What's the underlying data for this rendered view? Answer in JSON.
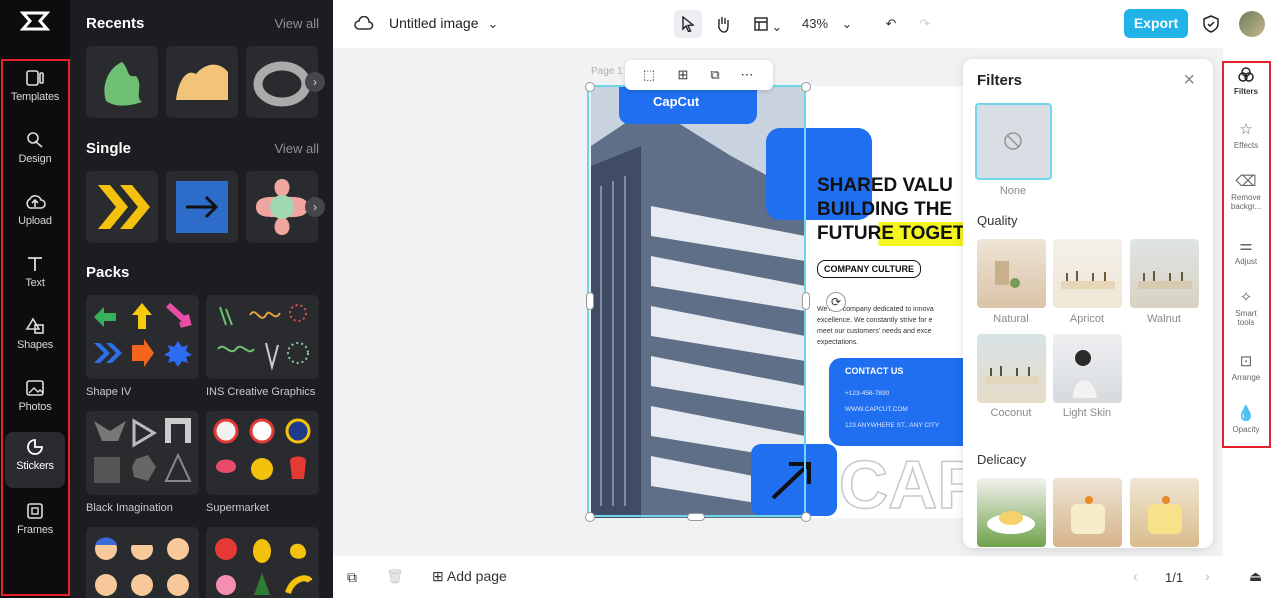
{
  "rail": {
    "items": [
      {
        "label": "Templates"
      },
      {
        "label": "Design"
      },
      {
        "label": "Upload"
      },
      {
        "label": "Text"
      },
      {
        "label": "Shapes"
      },
      {
        "label": "Photos"
      },
      {
        "label": "Stickers"
      },
      {
        "label": "Frames"
      }
    ]
  },
  "panel": {
    "recents_title": "Recents",
    "single_title": "Single",
    "packs_title": "Packs",
    "view_all": "View all",
    "packs": [
      {
        "label": "Shape IV"
      },
      {
        "label": "INS Creative Graphics"
      },
      {
        "label": "Black Imagination"
      },
      {
        "label": "Supermarket"
      }
    ]
  },
  "topbar": {
    "doc_title": "Untitled image",
    "zoom": "43%",
    "export_label": "Export"
  },
  "canvas": {
    "page_label": "Page 1",
    "brand": "CapCut",
    "headline": [
      "SHARED VALU",
      "BUILDING THE",
      "FUTURE TOGET"
    ],
    "badge": "COMPANY CULTURE",
    "body": [
      "We're a company dedicated to innova",
      "excellence. We constantly strive for e",
      "meet our customers' needs and exce",
      "expectations."
    ],
    "contact_title": "CONTACT US",
    "contact": [
      "+123-456-7890",
      "WWW.CAPCUT.COM",
      "123 ANYWHERE ST., ANY CITY"
    ],
    "big_text": "CAP"
  },
  "bottombar": {
    "add_page": "Add page",
    "pager": "1/1"
  },
  "filters": {
    "title": "Filters",
    "none_label": "None",
    "quality_title": "Quality",
    "quality": [
      {
        "label": "Natural"
      },
      {
        "label": "Apricot"
      },
      {
        "label": "Walnut"
      },
      {
        "label": "Coconut"
      },
      {
        "label": "Light Skin"
      }
    ],
    "delicacy_title": "Delicacy"
  },
  "tools": {
    "items": [
      {
        "label": "Filters"
      },
      {
        "label": "Effects"
      },
      {
        "label": "Remove backgr..."
      },
      {
        "label": "Adjust"
      },
      {
        "label": "Smart tools"
      },
      {
        "label": "Arrange"
      },
      {
        "label": "Opacity"
      }
    ]
  },
  "colors": {
    "accent": "#1fb3e8",
    "highlight": "#e5212c",
    "brand_blue": "#1f6ff0"
  }
}
